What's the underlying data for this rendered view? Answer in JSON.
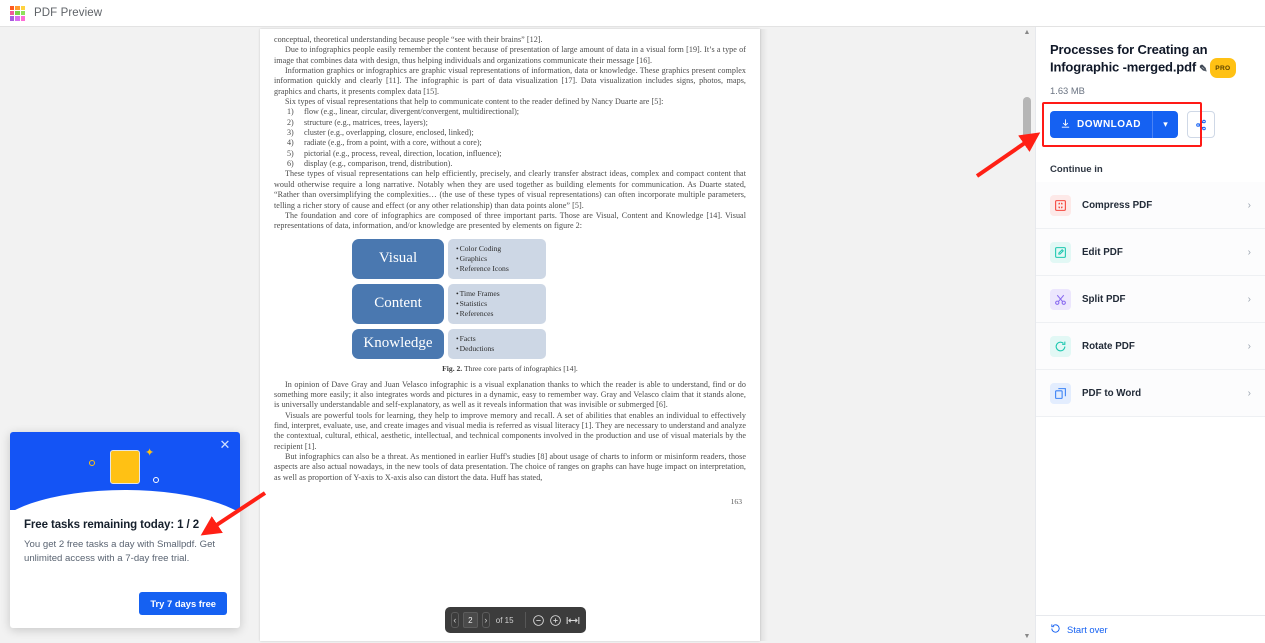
{
  "titlebar": {
    "app_name": "PDF Preview",
    "logo_icon": "color-grid-logo"
  },
  "viewer": {
    "pager": {
      "prev_icon": "chevron-left-icon",
      "page_value": "2",
      "next_icon": "chevron-right-icon",
      "of_total": "of 15",
      "zoom_out_icon": "zoom-out-icon",
      "zoom_in_icon": "zoom-in-icon",
      "fit_width_icon": "fit-width-icon"
    },
    "document": {
      "paragraphs": [
        "conceptual, theoretical understanding because people “see with their brains” [12].",
        "Due to infographics people easily remember the content because of presentation of large amount of data in a visual form [19]. It’s a type of image that combines data with design, thus helping individuals and organizations communicate their message [16].",
        "Information graphics or infographics are graphic visual representations of information, data or knowledge. These graphics present complex information quickly and clearly [11]. The infographic is part of data visualization [17]. Data visualization includes signs, photos, maps, graphics and charts, it presents complex data [15].",
        "Six types of visual representations that help to communicate content to the reader defined by Nancy Duarte are [5]:"
      ],
      "list_items": [
        {
          "num": "1)",
          "text": "flow (e.g., linear, circular, divergent/convergent, multidirectional);"
        },
        {
          "num": "2)",
          "text": "structure (e.g., matrices, trees, layers);"
        },
        {
          "num": "3)",
          "text": "cluster (e.g., overlapping, closure, enclosed, linked);"
        },
        {
          "num": "4)",
          "text": "radiate (e.g., from a point, with a core, without a core);"
        },
        {
          "num": "5)",
          "text": "pictorial (e.g., process, reveal, direction, location, influence);"
        },
        {
          "num": "6)",
          "text": "display (e.g., comparison, trend, distribution)."
        }
      ],
      "paragraphs2": [
        "These types of visual representations can help efficiently, precisely, and clearly transfer abstract ideas, complex and compact content that would otherwise require a long narrative. Notably when they are used together as building elements for communication. As Duarte stated, “Rather than oversimplifying the complexities… (the use of these types of visual representations) can often incorporate multiple parameters, telling a richer story of cause and effect (or any other relationship) than data points alone” [5].",
        "The foundation and core of infographics are composed of three important parts. Those are Visual, Content and Knowledge [14]. Visual representations of data, information, and/or knowledge are presented by elements on figure 2:"
      ],
      "figure": {
        "rows": [
          {
            "label": "Visual",
            "bullets": [
              "Color Coding",
              "Graphics",
              "Reference Icons"
            ]
          },
          {
            "label": "Content",
            "bullets": [
              "Time Frames",
              "Statistics",
              "References"
            ]
          },
          {
            "label": "Knowledge",
            "bullets": [
              "Facts",
              "Deductions"
            ]
          }
        ],
        "caption_bold": "Fig. 2.",
        "caption_text": " Three core parts of infographics [14]."
      },
      "paragraphs3": [
        "In opinion of Dave Gray and Juan Velasco infographic is a visual explanation thanks to which the reader is able to understand, find or do something more easily; it also integrates words and pictures in a dynamic, easy to remember way. Gray and Velasco claim that it stands alone, is universally understandable and self-explanatory, as well as it reveals information that was invisible or submerged [6].",
        "Visuals are powerful tools for learning, they help to improve memory and recall. A set of abilities that enables an individual to effectively find, interpret, evaluate, use, and create images and visual media is referred as visual literacy [1]. They are necessary to understand and analyze the contextual, cultural, ethical, aesthetic, intellectual, and technical components involved in the production and use of visual materials by the recipient [1].",
        "But infographics can also be a threat. As mentioned in earlier Huff's studies [8] about usage of charts to inform or misinform readers, those aspects are also actual nowadays, in the new tools of data presentation. The choice of ranges on graphs can have huge impact on interpretation, as well as proportion of Y-axis to X-axis also can distort the data. Huff has stated,"
      ],
      "page_number": "163"
    }
  },
  "promo": {
    "close_icon": "close-icon",
    "title": "Free tasks remaining today: 1 / 2",
    "subtitle": "You get 2 free tasks a day with Smallpdf. Get unlimited access with a 7-day free trial.",
    "cta_label": "Try 7 days free"
  },
  "sidebar": {
    "file_name": "Processes for Creating an Infographic -merged.pdf",
    "edit_icon": "pencil-icon",
    "pro_badge": "PRO",
    "file_size": "1.63 MB",
    "download_label": "DOWNLOAD",
    "download_icon": "download-icon",
    "download_caret_icon": "chevron-down-icon",
    "share_icon": "share-icon",
    "section_title": "Continue in",
    "tools": [
      {
        "label": "Compress PDF",
        "icon": "compress-pdf-icon",
        "color": "#f5453d",
        "bg": "#fde9e8"
      },
      {
        "label": "Edit PDF",
        "icon": "edit-pdf-icon",
        "color": "#1ec8b0",
        "bg": "#e2f8f5"
      },
      {
        "label": "Split PDF",
        "icon": "split-pdf-icon",
        "color": "#8a6bf0",
        "bg": "#ece6fd"
      },
      {
        "label": "Rotate PDF",
        "icon": "rotate-pdf-icon",
        "color": "#1ec8b0",
        "bg": "#e2f8f5"
      },
      {
        "label": "PDF to Word",
        "icon": "pdf-to-word-icon",
        "color": "#3b82f6",
        "bg": "#e3edfe"
      }
    ],
    "chevron_icon": "chevron-right-icon",
    "start_over_label": "Start over",
    "start_over_icon": "refresh-icon"
  },
  "annotations": {
    "arrow_color": "#ff2015",
    "highlight_color": "#ff1a16"
  }
}
